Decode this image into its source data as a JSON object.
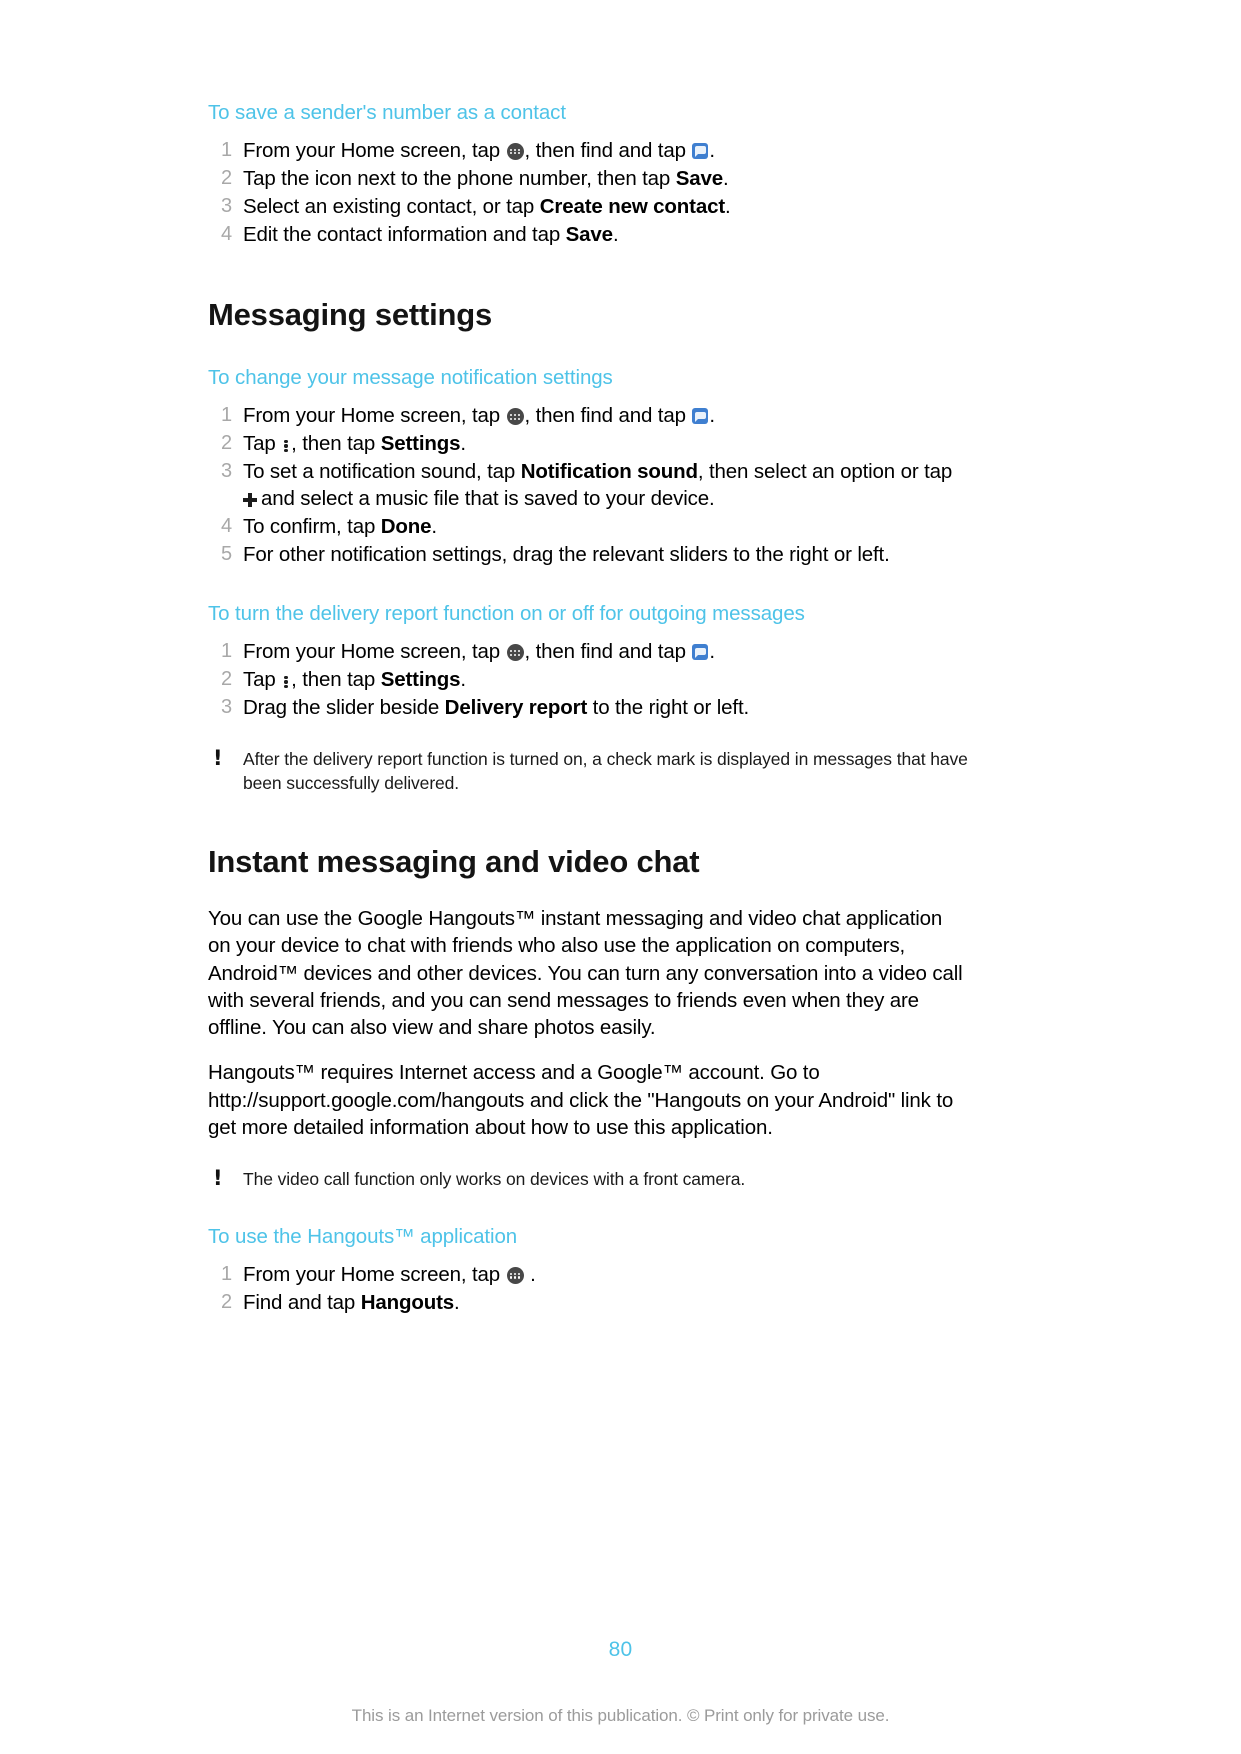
{
  "accent_color": "#4ec3e8",
  "muted_number_color": "#a8a8a8",
  "footer_text_color": "#9b9b9b",
  "procedures": {
    "save_sender": {
      "title": "To save a sender's number as a contact",
      "steps": {
        "s1_a": "From your Home screen, tap ",
        "s1_b": ", then find and tap ",
        "s1_c": ".",
        "s2_a": "Tap the icon next to the phone number, then tap ",
        "s2_bold": "Save",
        "s2_b": ".",
        "s3_a": "Select an existing contact, or tap ",
        "s3_bold": "Create new contact",
        "s3_b": ".",
        "s4_a": "Edit the contact information and tap ",
        "s4_bold": "Save",
        "s4_b": "."
      }
    },
    "notification_settings": {
      "title": "To change your message notification settings",
      "steps": {
        "s1_a": "From your Home screen, tap ",
        "s1_b": ", then find and tap ",
        "s1_c": ".",
        "s2_a": "Tap ",
        "s2_b": ", then tap ",
        "s2_bold": "Settings",
        "s2_c": ".",
        "s3_a": "To set a notification sound, tap ",
        "s3_bold": "Notification sound",
        "s3_b": ", then select an option or tap ",
        "s3_c": "and select a music file that is saved to your device.",
        "s4_a": "To confirm, tap ",
        "s4_bold": "Done",
        "s4_b": ".",
        "s5": "For other notification settings, drag the relevant sliders to the right or left."
      }
    },
    "delivery_report": {
      "title": "To turn the delivery report function on or off for outgoing messages",
      "steps": {
        "s1_a": "From your Home screen, tap ",
        "s1_b": ", then find and tap ",
        "s1_c": ".",
        "s2_a": "Tap ",
        "s2_b": ", then tap ",
        "s2_bold": "Settings",
        "s2_c": ".",
        "s3_a": "Drag the slider beside ",
        "s3_bold": "Delivery report",
        "s3_b": " to the right or left."
      }
    },
    "use_hangouts": {
      "title": "To use the Hangouts™ application",
      "steps": {
        "s1_a": "From your Home screen, tap ",
        "s1_b": ".",
        "s2_a": "Find and tap ",
        "s2_bold": "Hangouts",
        "s2_b": "."
      }
    }
  },
  "sections": {
    "messaging_settings": {
      "heading": "Messaging settings"
    },
    "instant_messaging": {
      "heading": "Instant messaging and video chat",
      "paragraph_1": "You can use the Google Hangouts™ instant messaging and video chat application on your device to chat with friends who also use the application on computers, Android™ devices and other devices. You can turn any conversation into a video call with several friends, and you can send messages to friends even when they are offline. You can also view and share photos easily.",
      "paragraph_2": "Hangouts™ requires Internet access and a Google™ account. Go to http://support.google.com/hangouts and click the \"Hangouts on your Android\" link to get more detailed information about how to use this application."
    }
  },
  "notes": {
    "delivery_report_note": "After the delivery report function is turned on, a check mark is displayed in messages that have been successfully delivered.",
    "video_call_note": "The video call function only works on devices with a front camera."
  },
  "footer": {
    "page_number": "80",
    "disclaimer": "This is an Internet version of this publication. © Print only for private use."
  },
  "step_numbers": {
    "n1": "1",
    "n2": "2",
    "n3": "3",
    "n4": "4",
    "n5": "5"
  }
}
